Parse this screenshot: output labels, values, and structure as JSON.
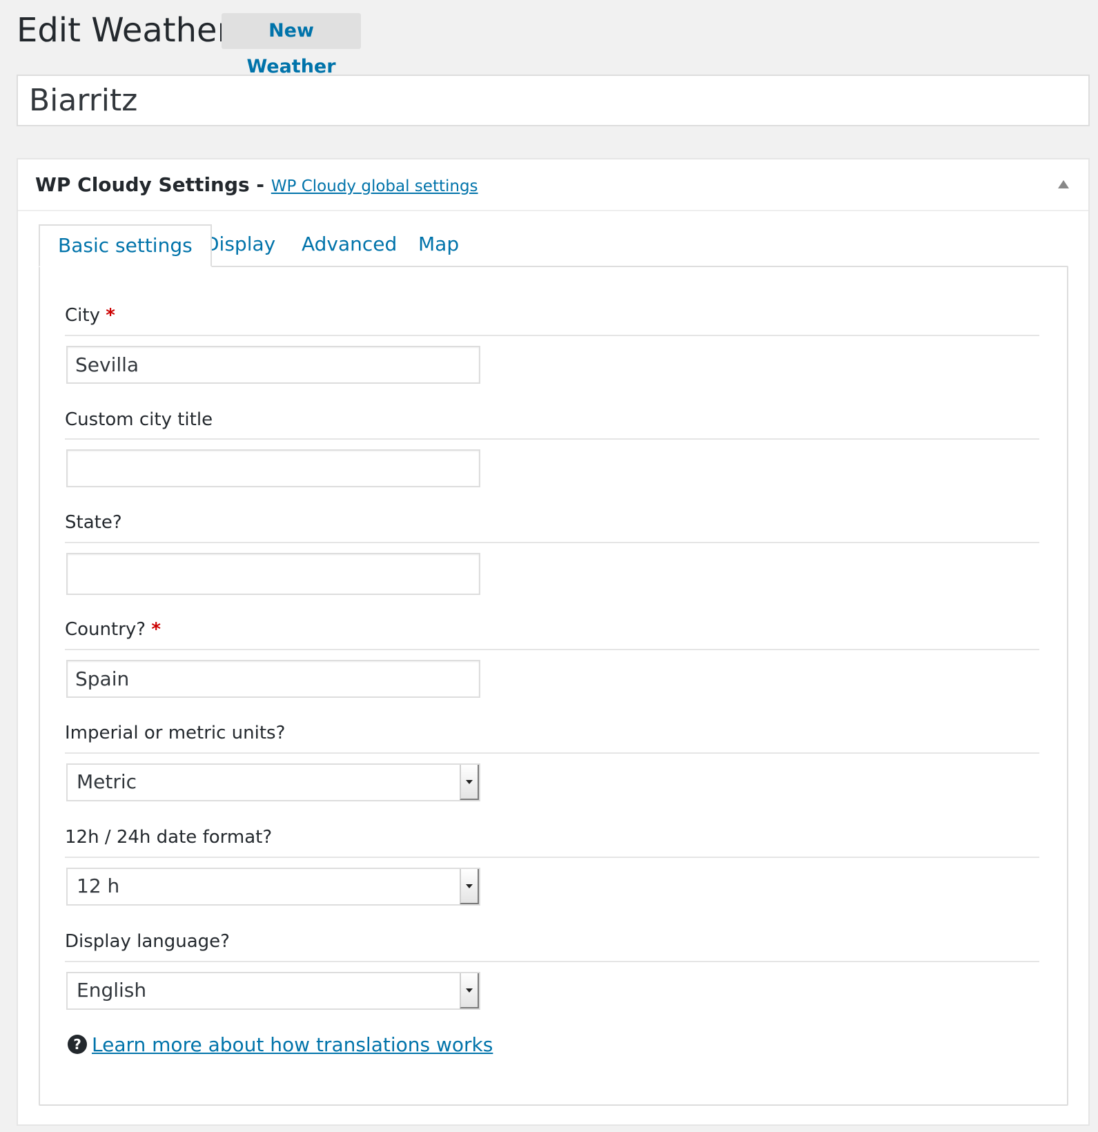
{
  "header": {
    "title": "Edit Weather",
    "add_new_label": "New Weather"
  },
  "post_title": {
    "value": "Biarritz"
  },
  "postbox": {
    "title": "WP Cloudy Settings",
    "separator": " - ",
    "global_settings_link": "WP Cloudy global settings"
  },
  "tabs": [
    {
      "label": "Basic settings",
      "active": true
    },
    {
      "label": "Display",
      "active": false
    },
    {
      "label": "Advanced",
      "active": false
    },
    {
      "label": "Map",
      "active": false
    }
  ],
  "fields": {
    "city": {
      "label": "City",
      "required_mark": "*",
      "value": "Sevilla"
    },
    "custom_city_title": {
      "label": "Custom city title",
      "value": ""
    },
    "state": {
      "label": "State?",
      "value": ""
    },
    "country": {
      "label": "Country?",
      "required_mark": "*",
      "value": "Spain"
    },
    "units": {
      "label": "Imperial or metric units?",
      "selected": "Metric"
    },
    "date_format": {
      "label": "12h / 24h date format?",
      "selected": "12 h"
    },
    "language": {
      "label": "Display language?",
      "selected": "English"
    }
  },
  "help": {
    "icon": "question-circle-icon",
    "link_text": "Learn more about how translations works"
  },
  "colors": {
    "link": "#0073aa",
    "required": "#cc0000",
    "background": "#f1f1f1"
  }
}
